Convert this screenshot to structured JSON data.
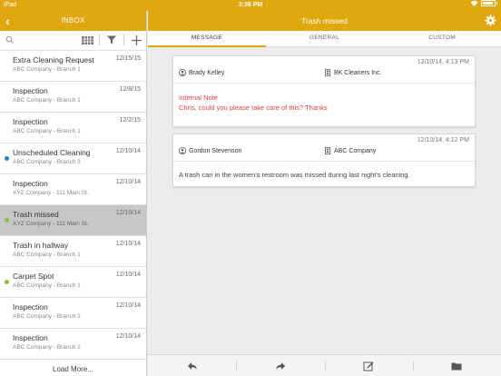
{
  "statusbar": {
    "carrier": "iPad",
    "time": "3:36 PM"
  },
  "inbox": {
    "back_glyph": "‹",
    "title": "INBOX",
    "items": [
      {
        "subject": "Extra Cleaning Request",
        "location": "ABC Company - Branch 1",
        "date": "12/15/15",
        "dot": ""
      },
      {
        "subject": "Inspection",
        "location": "ABC Company - Branch 1",
        "date": "12/8/15",
        "dot": ""
      },
      {
        "subject": "Inspection",
        "location": "ABC Company - Branch 1",
        "date": "12/2/15",
        "dot": ""
      },
      {
        "subject": "Unscheduled Cleaning",
        "location": "ABC Company - Branch 3",
        "date": "12/10/14",
        "dot": "#1f86c7"
      },
      {
        "subject": "Inspection",
        "location": "XYZ Company - 111 Main St.",
        "date": "12/10/14",
        "dot": ""
      },
      {
        "subject": "Trash missed",
        "location": "XYZ Company - 111 Main St.",
        "date": "12/10/14",
        "dot": "#8cbf3f"
      },
      {
        "subject": "Trash in hallway",
        "location": "ABC Company - Branch 1",
        "date": "12/10/14",
        "dot": ""
      },
      {
        "subject": "Carpet Spot",
        "location": "ABC Company - Branch 1",
        "date": "12/10/14",
        "dot": "#8cbf3f"
      },
      {
        "subject": "Inspection",
        "location": "ABC Company - Branch 2",
        "date": "12/10/14",
        "dot": ""
      },
      {
        "subject": "Inspection",
        "location": "ABC Company - Branch 2",
        "date": "12/10/14",
        "dot": ""
      }
    ],
    "selected_index": 5,
    "load_more": "Load More..."
  },
  "detail": {
    "title": "Trash missed",
    "tabs": [
      "MESSAGE",
      "GENERAL",
      "CUSTOM"
    ],
    "active_tab": 0,
    "messages": [
      {
        "timestamp": "12/10/14, 4:13 PM",
        "from": "Brady Kelley",
        "to": "BK Cleaners Inc.",
        "note_label": "Internal Note",
        "text": "Chris, could you please take care of this? Thanks"
      },
      {
        "timestamp": "12/10/14, 4:12 PM",
        "from": "Gordon Stevenson",
        "to": "ABC Company",
        "text": "A trash can in the women's restroom was missed during last night's cleaning."
      }
    ]
  },
  "colors": {
    "accent": "#e1a70f",
    "note": "#e64040",
    "selected_row": "#c7c7c7"
  },
  "icons": {
    "statusbar": [
      "wifi-icon",
      "battery-icon"
    ],
    "inbox": [
      "back-icon",
      "search-icon",
      "grid-icon",
      "filter-icon",
      "add-icon"
    ],
    "detail": [
      "settings-icon",
      "person-icon",
      "building-icon"
    ],
    "toolbar": [
      "reply-icon",
      "forward-icon",
      "compose-icon",
      "folder-icon"
    ]
  }
}
